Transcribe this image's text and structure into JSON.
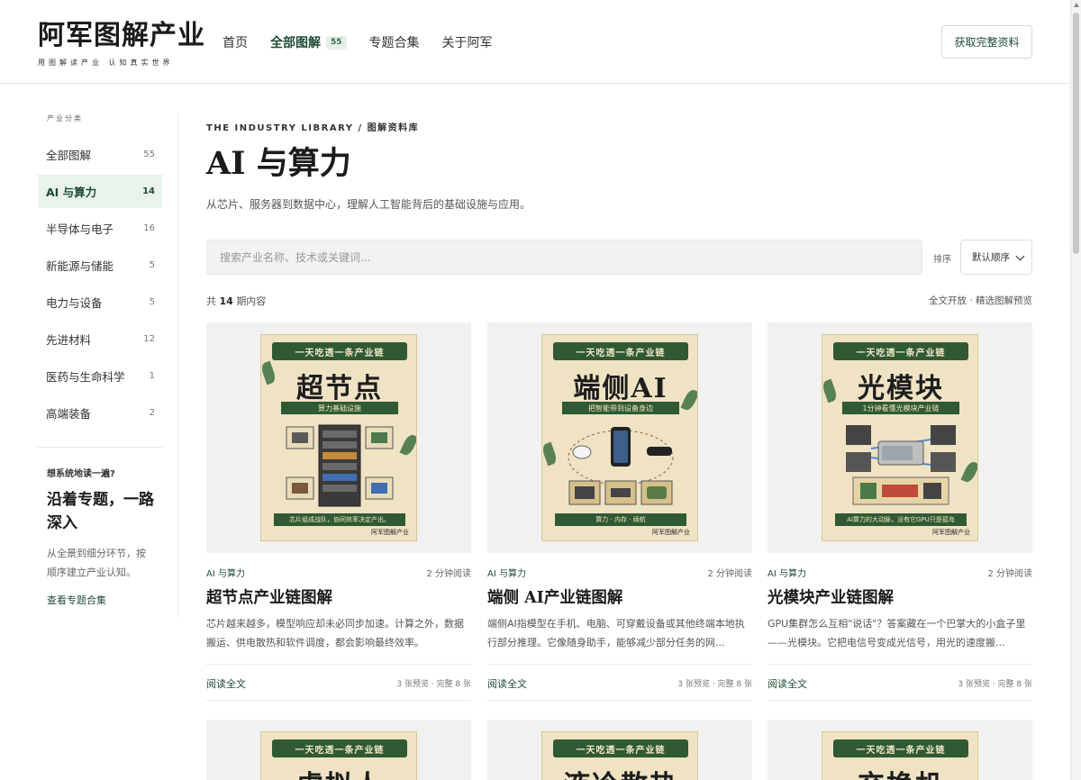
{
  "header": {
    "logo_title": "阿军图解产业",
    "logo_subtitle": "用图解读产业 认知真实世界",
    "nav": [
      {
        "label": "首页",
        "active": false,
        "badge": ""
      },
      {
        "label": "全部图解",
        "active": true,
        "badge": "55"
      },
      {
        "label": "专题合集",
        "active": false,
        "badge": ""
      },
      {
        "label": "关于阿军",
        "active": false,
        "badge": ""
      }
    ],
    "cta_label": "获取完整资料"
  },
  "sidebar": {
    "section_label": "产业分类",
    "items": [
      {
        "label": "全部图解",
        "count": "55",
        "active": false
      },
      {
        "label": "AI 与算力",
        "count": "14",
        "active": true
      },
      {
        "label": "半导体与电子",
        "count": "16",
        "active": false
      },
      {
        "label": "新能源与储能",
        "count": "5",
        "active": false
      },
      {
        "label": "电力与设备",
        "count": "5",
        "active": false
      },
      {
        "label": "先进材料",
        "count": "12",
        "active": false
      },
      {
        "label": "医药与生命科学",
        "count": "1",
        "active": false
      },
      {
        "label": "高端装备",
        "count": "2",
        "active": false
      }
    ],
    "promo": {
      "question": "想系统地读一遍?",
      "title": "沿着专题，一路深入",
      "description": "从全景到细分环节，按顺序建立产业认知。",
      "link": "查看专题合集"
    }
  },
  "main": {
    "eyebrow": "THE INDUSTRY LIBRARY / 图解资料库",
    "title": "AI 与算力",
    "description": "从芯片、服务器到数据中心，理解人工智能背后的基础设施与应用。",
    "search_placeholder": "搜索产业名称、技术或关键词...",
    "sort_label": "排序",
    "sort_value": "默认顺序",
    "count_prefix": "共",
    "count_value": "14",
    "count_suffix": "期内容",
    "count_right": "全文开放 · 精选图解预览"
  },
  "cards": [
    {
      "category": "AI 与算力",
      "read_time": "2 分钟阅读",
      "title": "超节点产业链图解",
      "description": "芯片越来越多，模型响应却未必同步加速。计算之外，数据搬运、供电散热和软件调度，都会影响最终效率。",
      "read_label": "阅读全文",
      "stats": "3 张预览 · 完整 8 张",
      "poster": {
        "banner": "一天吃透一条产业链",
        "title": "超节点",
        "ribbon": "算力基础设施",
        "foot": "芯片组成战队，协同效率决定产出。",
        "sign": "阿军图解产业"
      }
    },
    {
      "category": "AI 与算力",
      "read_time": "2 分钟阅读",
      "title": "端侧 AI产业链图解",
      "description": "端侧AI指模型在手机、电脑、可穿戴设备或其他终端本地执行部分推理。它像随身助手，能够减少部分任务的网...",
      "read_label": "阅读全文",
      "stats": "3 张预览 · 完整 8 张",
      "poster": {
        "banner": "一天吃透一条产业链",
        "title": "端侧AI",
        "ribbon": "把智能带到设备身边",
        "foot": "算力 · 内存 · 续航",
        "sign": "阿军图解产业"
      }
    },
    {
      "category": "AI 与算力",
      "read_time": "2 分钟阅读",
      "title": "光模块产业链图解",
      "description": "GPU集群怎么互相\"说话\"？答案藏在一个巴掌大的小盒子里——光模块。它把电信号变成光信号，用光的速度搬...",
      "read_label": "阅读全文",
      "stats": "3 张预览 · 完整 8 张",
      "poster": {
        "banner": "一天吃透一条产业链",
        "title": "光模块",
        "ribbon": "1分钟看懂光模块产业链",
        "foot": "AI算力的大动脉，没有它GPU只是孤岛",
        "sign": "阿军图解产业"
      }
    },
    {
      "poster": {
        "banner": "一天吃透一条产业链",
        "title": "虚拟人"
      }
    },
    {
      "poster": {
        "banner": "一天吃透一条产业链",
        "title": "液冷散热"
      }
    },
    {
      "poster": {
        "banner": "一天吃透一条产业链",
        "title": "交换机"
      }
    }
  ],
  "colors": {
    "accent": "#1f4d36",
    "active_bg": "#eaf2ec",
    "poster_bg": "#efe3c4",
    "poster_green": "#2f5a34"
  }
}
